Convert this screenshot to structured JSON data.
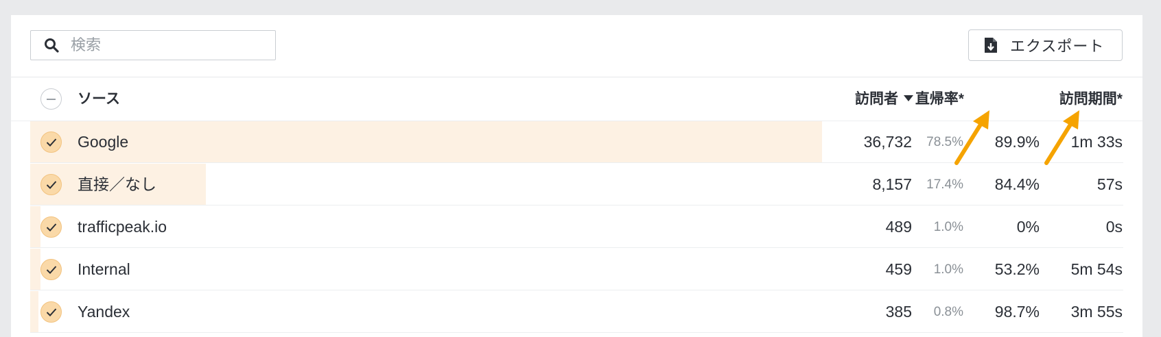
{
  "search": {
    "placeholder": "検索"
  },
  "toolbar": {
    "export_label": "エクスポート"
  },
  "columns": {
    "source": "ソース",
    "visitors": "訪問者",
    "bounce_rate": "直帰率*",
    "visit_duration": "訪問期間*"
  },
  "rows": [
    {
      "source": "Google",
      "visitors": "36,732",
      "percent": "78.5%",
      "bounce": "89.9%",
      "duration": "1m 33s",
      "share": 0.785
    },
    {
      "source": "直接／なし",
      "visitors": "8,157",
      "percent": "17.4%",
      "bounce": "84.4%",
      "duration": "57s",
      "share": 0.174
    },
    {
      "source": "trafficpeak.io",
      "visitors": "489",
      "percent": "1.0%",
      "bounce": "0%",
      "duration": "0s",
      "share": 0.01
    },
    {
      "source": "Internal",
      "visitors": "459",
      "percent": "1.0%",
      "bounce": "53.2%",
      "duration": "5m 54s",
      "share": 0.01
    },
    {
      "source": "Yandex",
      "visitors": "385",
      "percent": "0.8%",
      "bounce": "98.7%",
      "duration": "3m 55s",
      "share": 0.008
    }
  ],
  "colors": {
    "bar": "#fdf1e3",
    "check": "#fad9a8",
    "annotation_arrow": "#f5a300"
  }
}
